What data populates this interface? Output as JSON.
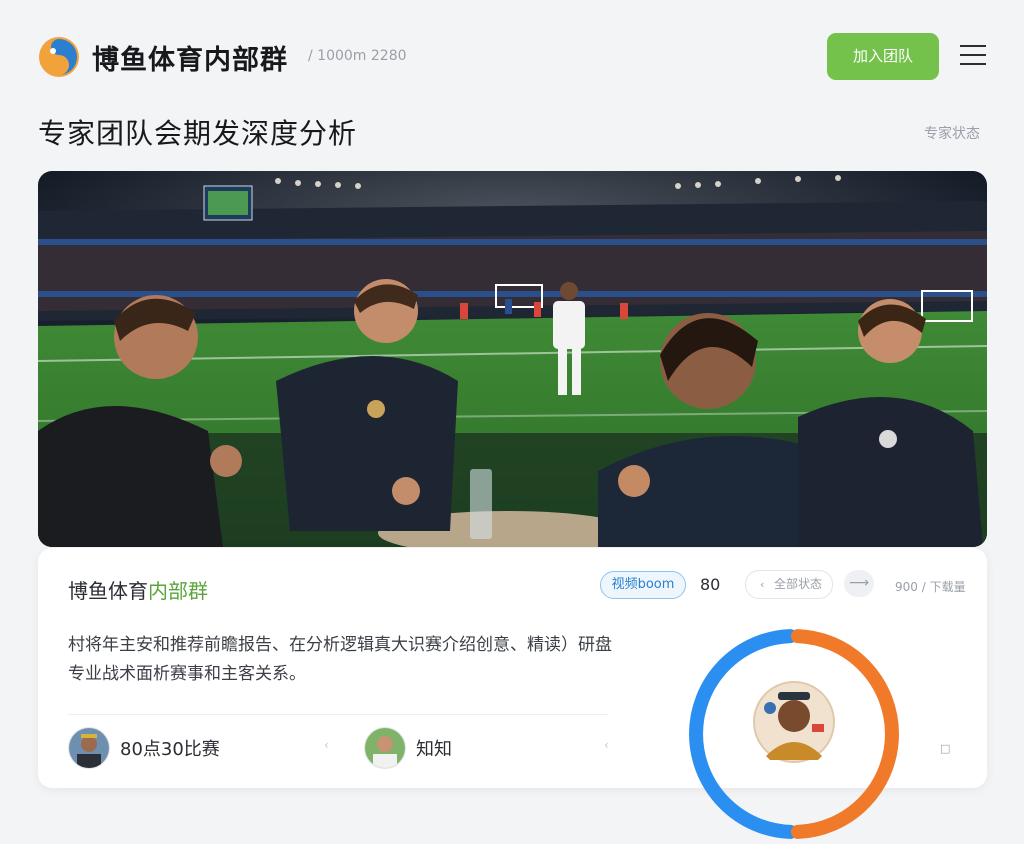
{
  "header": {
    "brand_title": "博鱼体育内部群",
    "brand_subtitle": "/ 1000m 2280",
    "cta_label": "加入团队",
    "logo_icon": "fish-logo-icon",
    "menu_icon": "hamburger-menu-icon"
  },
  "section": {
    "title": "专家团队会期发深度分析",
    "link_label": "专家状态"
  },
  "hero": {
    "scene": "stadium-pitch-analysts-image"
  },
  "card": {
    "title_prefix": "博鱼体育",
    "title_accent": "内部群",
    "tag_label": "视频boom",
    "count": "80",
    "dropdown_label": "全部状态",
    "dropdown_icon": "chevron-left-icon",
    "next_icon": "arrow-right-icon",
    "meta": "900 / 下载量",
    "description": "村将年主安和推荐前瞻报告、在分析逻辑真大识赛介绍创意、精读）研盘专业战术面析赛事和主客关系。",
    "people": [
      {
        "name": "80点30比赛",
        "avatar": "player-avatar-icon"
      },
      {
        "name": "知知",
        "avatar": "player-avatar-icon"
      }
    ],
    "ring": {
      "blue_share": 0.5,
      "orange_share": 0.5,
      "center_icon": "analyst-avatar-icon"
    },
    "ring_meta": "□"
  },
  "colors": {
    "accent_green": "#74c24b",
    "ring_blue": "#2a8ff0",
    "ring_orange": "#f07a2a",
    "tag_blue": "#2a7fd0"
  }
}
